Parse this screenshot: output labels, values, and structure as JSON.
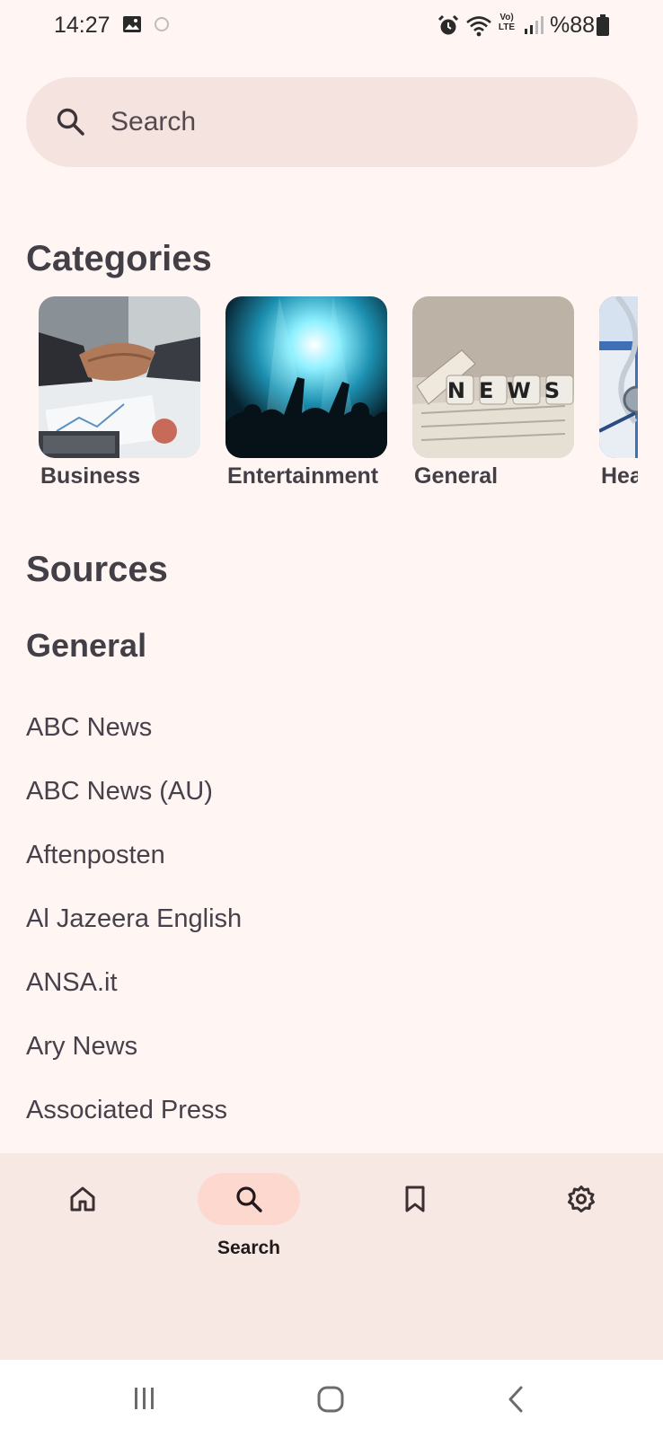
{
  "status_bar": {
    "time": "14:27",
    "battery": "%88",
    "left_icons": [
      "image-icon",
      "loading-icon"
    ],
    "right_icons": [
      "alarm-icon",
      "wifi-icon",
      "volte-icon",
      "signal-icon",
      "battery-icon"
    ],
    "volte_text": "Vo) LTE"
  },
  "search": {
    "placeholder": "Search"
  },
  "categories": {
    "title": "Categories",
    "items": [
      {
        "label": "Business",
        "image": "handshake-over-charts"
      },
      {
        "label": "Entertainment",
        "image": "concert-crowd"
      },
      {
        "label": "General",
        "image": "news-letter-blocks"
      },
      {
        "label": "Health",
        "image": "stethoscope"
      }
    ]
  },
  "sources": {
    "title": "Sources",
    "group_title": "General",
    "items": [
      "ABC News",
      "ABC News (AU)",
      "Aftenposten",
      "Al Jazeera English",
      "ANSA.it",
      "Ary News",
      "Associated Press"
    ]
  },
  "bottom_nav": {
    "items": [
      {
        "icon": "home-icon",
        "label": "",
        "active": false
      },
      {
        "icon": "search-icon",
        "label": "Search",
        "active": true
      },
      {
        "icon": "bookmark-icon",
        "label": "",
        "active": false
      },
      {
        "icon": "settings-icon",
        "label": "",
        "active": false
      }
    ]
  },
  "news_blocks_text": "NEWS",
  "colors": {
    "background": "#fff6f4",
    "search_bg": "#f5e3df",
    "nav_bg": "#f8e8e3",
    "nav_active_pill": "#fdd8cf",
    "text_primary": "#433f47"
  }
}
